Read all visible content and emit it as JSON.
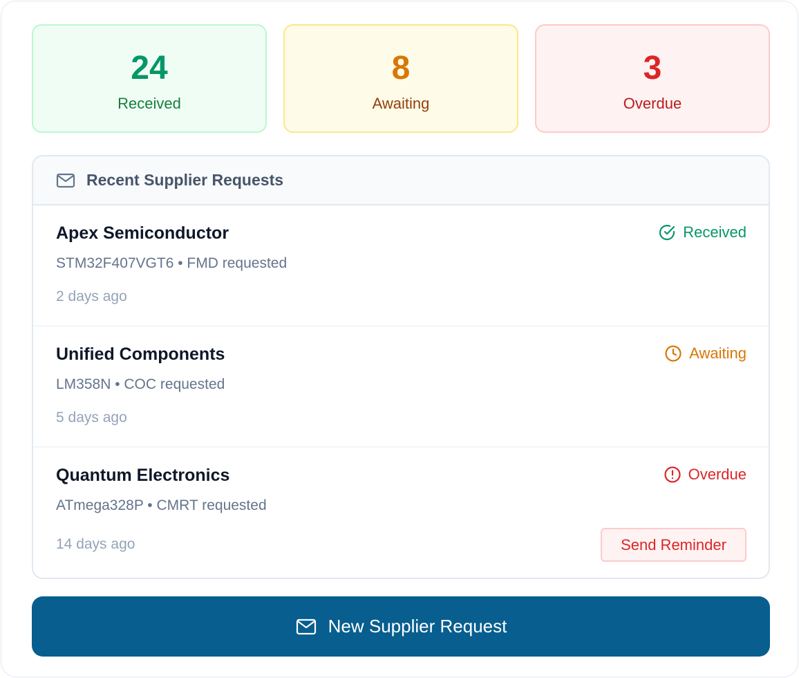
{
  "stats": [
    {
      "value": "24",
      "label": "Received"
    },
    {
      "value": "8",
      "label": "Awaiting"
    },
    {
      "value": "3",
      "label": "Overdue"
    }
  ],
  "panel": {
    "title": "Recent Supplier Requests",
    "icon": "mail-icon"
  },
  "requests": [
    {
      "supplier": "Apex Semiconductor",
      "detail": "STM32F407VGT6 • FMD requested",
      "time": "2 days ago",
      "status": "Received",
      "status_icon": "check-circle-icon",
      "status_color": "#059669"
    },
    {
      "supplier": "Unified Components",
      "detail": "LM358N • COC requested",
      "time": "5 days ago",
      "status": "Awaiting",
      "status_icon": "clock-icon",
      "status_color": "#d97706"
    },
    {
      "supplier": "Quantum Electronics",
      "detail": "ATmega328P • CMRT requested",
      "time": "14 days ago",
      "status": "Overdue",
      "status_icon": "alert-circle-icon",
      "status_color": "#dc2626",
      "action_label": "Send Reminder"
    }
  ],
  "primary_action": {
    "label": "New Supplier Request",
    "icon": "mail-icon"
  },
  "colors": {
    "primary": "#075e8f",
    "received": "#059669",
    "awaiting": "#d97706",
    "overdue": "#dc2626"
  }
}
